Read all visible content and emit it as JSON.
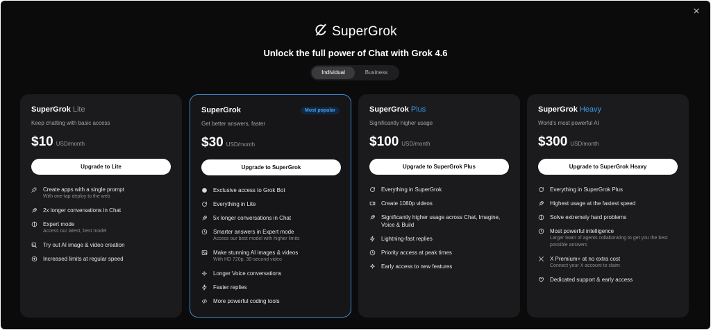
{
  "close_label": "×",
  "brand": {
    "name": "SuperGrok",
    "icon": "grok-logo-icon"
  },
  "subtitle": "Unlock the full power of Chat with Grok 4.6",
  "tabs": [
    {
      "label": "Individual",
      "active": true
    },
    {
      "label": "Business",
      "active": false
    }
  ],
  "colors": {
    "accent": "#3f9ae8",
    "popular_border": "#3f8bd4",
    "background": "#0b0b0c",
    "card": "#1b1b1d"
  },
  "plans": [
    {
      "name": "SuperGrok",
      "tier": "Lite",
      "description": "Keep chatting with basic access",
      "price": "$10",
      "unit": "USD/month",
      "cta": "Upgrade to Lite",
      "features": [
        {
          "icon": "sparkle-pen-icon",
          "text": "Create apps with a single prompt",
          "sub": "With one-tap deploy to the web"
        },
        {
          "icon": "rocket-icon",
          "text": "2x longer conversations in Chat"
        },
        {
          "icon": "brain-icon",
          "text": "Expert mode",
          "sub": "Access our latest, best model"
        },
        {
          "icon": "image-edit-icon",
          "text": "Try out AI image & video creation"
        },
        {
          "icon": "arrow-up-circle-icon",
          "text": "Increased limits at regular speed"
        }
      ]
    },
    {
      "name": "SuperGrok",
      "tier": "",
      "badge": "Most popular",
      "description": "Get better answers, faster",
      "price": "$30",
      "unit": "USD/month",
      "cta": "Upgrade to SuperGrok",
      "features": [
        {
          "icon": "dot-icon",
          "text": "Exclusive access to Grok Bot"
        },
        {
          "icon": "refresh-icon",
          "text": "Everything in Lite"
        },
        {
          "icon": "rocket-icon",
          "text": "5x longer conversations in Chat"
        },
        {
          "icon": "clock-icon",
          "text": "Smarter answers in Expert mode",
          "sub": "Access our best model with higher limits"
        },
        {
          "icon": "image-icon",
          "text": "Make stunning AI images & videos",
          "sub": "With HD 720p, 30-second video"
        },
        {
          "icon": "waveform-icon",
          "text": "Longer Voice conversations"
        },
        {
          "icon": "lightning-icon",
          "text": "Faster replies"
        },
        {
          "icon": "code-icon",
          "text": "More powerful coding tools"
        }
      ]
    },
    {
      "name": "SuperGrok",
      "tier": "Plus",
      "description": "Significantly higher usage",
      "price": "$100",
      "unit": "USD/month",
      "cta": "Upgrade to SuperGrok Plus",
      "features": [
        {
          "icon": "refresh-icon",
          "text": "Everything in SuperGrok"
        },
        {
          "icon": "video-icon",
          "text": "Create 1080p videos"
        },
        {
          "icon": "rocket-icon",
          "text": "Significantly higher usage across Chat, Imagine, Voice & Build"
        },
        {
          "icon": "lightning-icon",
          "text": "Lightning-fast replies"
        },
        {
          "icon": "clock-icon",
          "text": "Priority access at peak times"
        },
        {
          "icon": "sparkles-icon",
          "text": "Early access to new features"
        }
      ]
    },
    {
      "name": "SuperGrok",
      "tier": "Heavy",
      "description": "World's most powerful AI",
      "price": "$300",
      "unit": "USD/month",
      "cta": "Upgrade to SuperGrok Heavy",
      "features": [
        {
          "icon": "refresh-icon",
          "text": "Everything in SuperGrok Plus"
        },
        {
          "icon": "rocket-icon",
          "text": "Highest usage at the fastest speed"
        },
        {
          "icon": "brain-icon",
          "text": "Solve extremely hard problems"
        },
        {
          "icon": "clock-icon",
          "text": "Most powerful intelligence",
          "sub": "Larger team of agents collaborating to get you the best possible answers"
        },
        {
          "icon": "x-logo-icon",
          "text": "X Premium+ at no extra cost",
          "sub": "Connect your X account to claim"
        },
        {
          "icon": "heart-icon",
          "text": "Dedicated support & early access"
        }
      ]
    }
  ]
}
